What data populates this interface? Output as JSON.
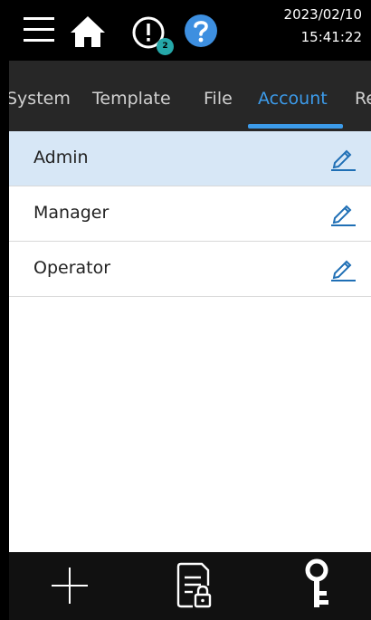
{
  "header": {
    "date": "2023/02/10",
    "time": "15:41:22",
    "alert_count": "2"
  },
  "tabs": [
    {
      "label": "System"
    },
    {
      "label": "Template"
    },
    {
      "label": "File"
    },
    {
      "label": "Account"
    },
    {
      "label": "Re"
    }
  ],
  "accounts": [
    {
      "name": "Admin"
    },
    {
      "name": "Manager"
    },
    {
      "name": "Operator"
    }
  ],
  "colors": {
    "accent": "#3c9bea",
    "badge": "#25a8a9",
    "selected_row": "#d7e7f6"
  },
  "icons": {
    "top": [
      "menu-icon",
      "home-icon",
      "alert-icon",
      "help-icon"
    ],
    "row": "edit-icon",
    "bottom": [
      "add-icon",
      "locked-document-icon",
      "key-icon"
    ]
  }
}
